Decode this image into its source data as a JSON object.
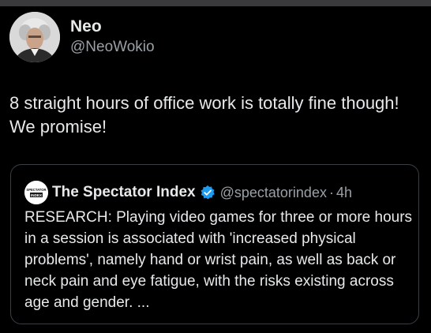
{
  "post": {
    "author_name": "Neo",
    "author_handle": "@NeoWokio",
    "text": "8 straight hours of office work is totally fine though! We promise!"
  },
  "quoted_post": {
    "author_name": "The Spectator Index",
    "author_handle": "@spectatorindex",
    "separator": "·",
    "time": "4h",
    "text": "RESEARCH: Playing video games for three or more hours in a session is associated with 'increased physical problems', namely hand or wrist pain, as well as back or neck pain and eye fatigue, with the risks existing across age and gender. ...",
    "avatar_logo_text": [
      "SPECTATOR",
      "INDEX"
    ],
    "verified_color": "#1d9bf0"
  },
  "icons": {
    "verified": "verified-badge-icon"
  },
  "colors": {
    "background": "#000000",
    "primary_text": "#e7e9ea",
    "secondary_text": "#9aa0a6",
    "card_border": "#3b3f44"
  }
}
